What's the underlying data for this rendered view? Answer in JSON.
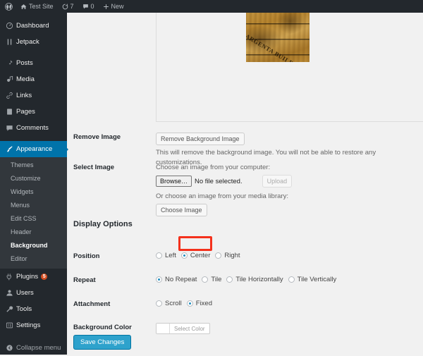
{
  "adminbar": {
    "logo_icon": "wordpress-logo-icon",
    "site": {
      "icon": "home-icon",
      "label": "Test Site"
    },
    "updates": {
      "icon": "updates-icon",
      "count": "7"
    },
    "comments": {
      "icon": "comment-bubble-icon",
      "count": "0"
    },
    "new": {
      "icon": "plus-icon",
      "label": "New"
    }
  },
  "sidebar": {
    "items": [
      {
        "label": "Dashboard",
        "icon": "dashboard-icon"
      },
      {
        "label": "Jetpack",
        "icon": "jetpack-icon"
      },
      {
        "label": "Posts",
        "icon": "pin-icon"
      },
      {
        "label": "Media",
        "icon": "media-icon"
      },
      {
        "label": "Links",
        "icon": "link-icon"
      },
      {
        "label": "Pages",
        "icon": "page-icon"
      },
      {
        "label": "Comments",
        "icon": "comment-bubble-icon"
      },
      {
        "label": "Appearance",
        "icon": "paintbrush-icon"
      },
      {
        "label": "Plugins",
        "icon": "plug-icon",
        "badge": "5"
      },
      {
        "label": "Users",
        "icon": "user-icon"
      },
      {
        "label": "Tools",
        "icon": "wrench-icon"
      },
      {
        "label": "Settings",
        "icon": "settings-gear-icon"
      }
    ],
    "submenu": [
      "Themes",
      "Customize",
      "Widgets",
      "Menus",
      "Edit CSS",
      "Header",
      "Background",
      "Editor"
    ],
    "submenu_current": "Background",
    "current_item": "Appearance",
    "collapse": {
      "label": "Collapse menu",
      "icon": "collapse-arrow-icon"
    }
  },
  "main": {
    "preview": {
      "watermark": "OR ARGENTA BUILDERS.COM MR"
    },
    "remove_image": {
      "label": "Remove Image",
      "button": "Remove Background Image",
      "help": "This will remove the background image. You will not be able to restore any customizations."
    },
    "select_image": {
      "label": "Select Image",
      "computer_help": "Choose an image from your computer:",
      "browse_button": "Browse…",
      "file_status": "No file selected.",
      "upload_button": "Upload",
      "library_help": "Or choose an image from your media library:",
      "choose_button": "Choose Image"
    },
    "display_options": {
      "heading": "Display Options",
      "position": {
        "label": "Position",
        "options": [
          "Left",
          "Center",
          "Right"
        ],
        "selected": "Center"
      },
      "repeat": {
        "label": "Repeat",
        "options": [
          "No Repeat",
          "Tile",
          "Tile Horizontally",
          "Tile Vertically"
        ],
        "selected": "No Repeat"
      },
      "attachment": {
        "label": "Attachment",
        "options": [
          "Scroll",
          "Fixed"
        ],
        "selected": "Fixed"
      },
      "background_color": {
        "label": "Background Color",
        "button": "Select Color"
      }
    },
    "save_button": "Save Changes"
  },
  "highlight": {
    "color": "#f4311c",
    "target": "Center"
  },
  "colors": {
    "admin_bg": "#23282d",
    "submenu_bg": "#32373c",
    "accent": "#0073aa",
    "primary_button": "#2ea2cc",
    "badge": "#d54e21",
    "content_bg": "#f1f1f1"
  }
}
